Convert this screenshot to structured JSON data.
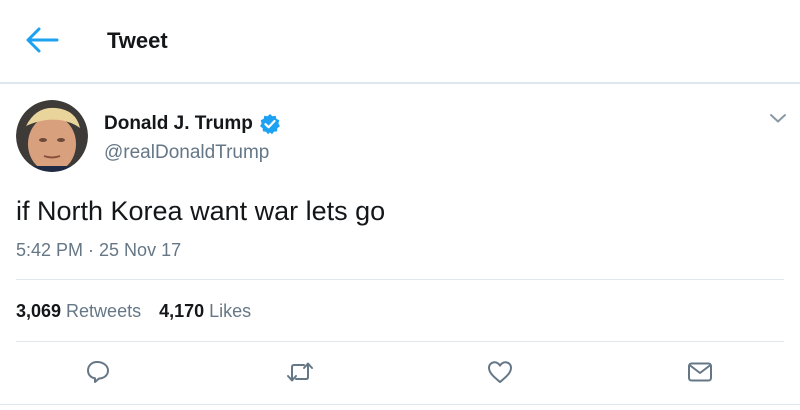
{
  "header": {
    "back_icon": "arrow-left-icon",
    "title": "Tweet"
  },
  "tweet": {
    "author": {
      "name": "Donald J. Trump",
      "handle": "@realDonaldTrump",
      "verified_icon": "verified-badge-icon"
    },
    "text": "if North Korea want war lets go",
    "timestamp": "5:42 PM · 25 Nov 17",
    "stats": {
      "retweets_count": "3,069",
      "retweets_label": "Retweets",
      "likes_count": "4,170",
      "likes_label": "Likes"
    },
    "actions": [
      "reply-icon",
      "retweet-icon",
      "like-icon",
      "share-icon"
    ]
  },
  "colors": {
    "accent": "#1da1f2",
    "text": "#14171a",
    "secondary": "#657786",
    "border": "#e1e8ed"
  }
}
